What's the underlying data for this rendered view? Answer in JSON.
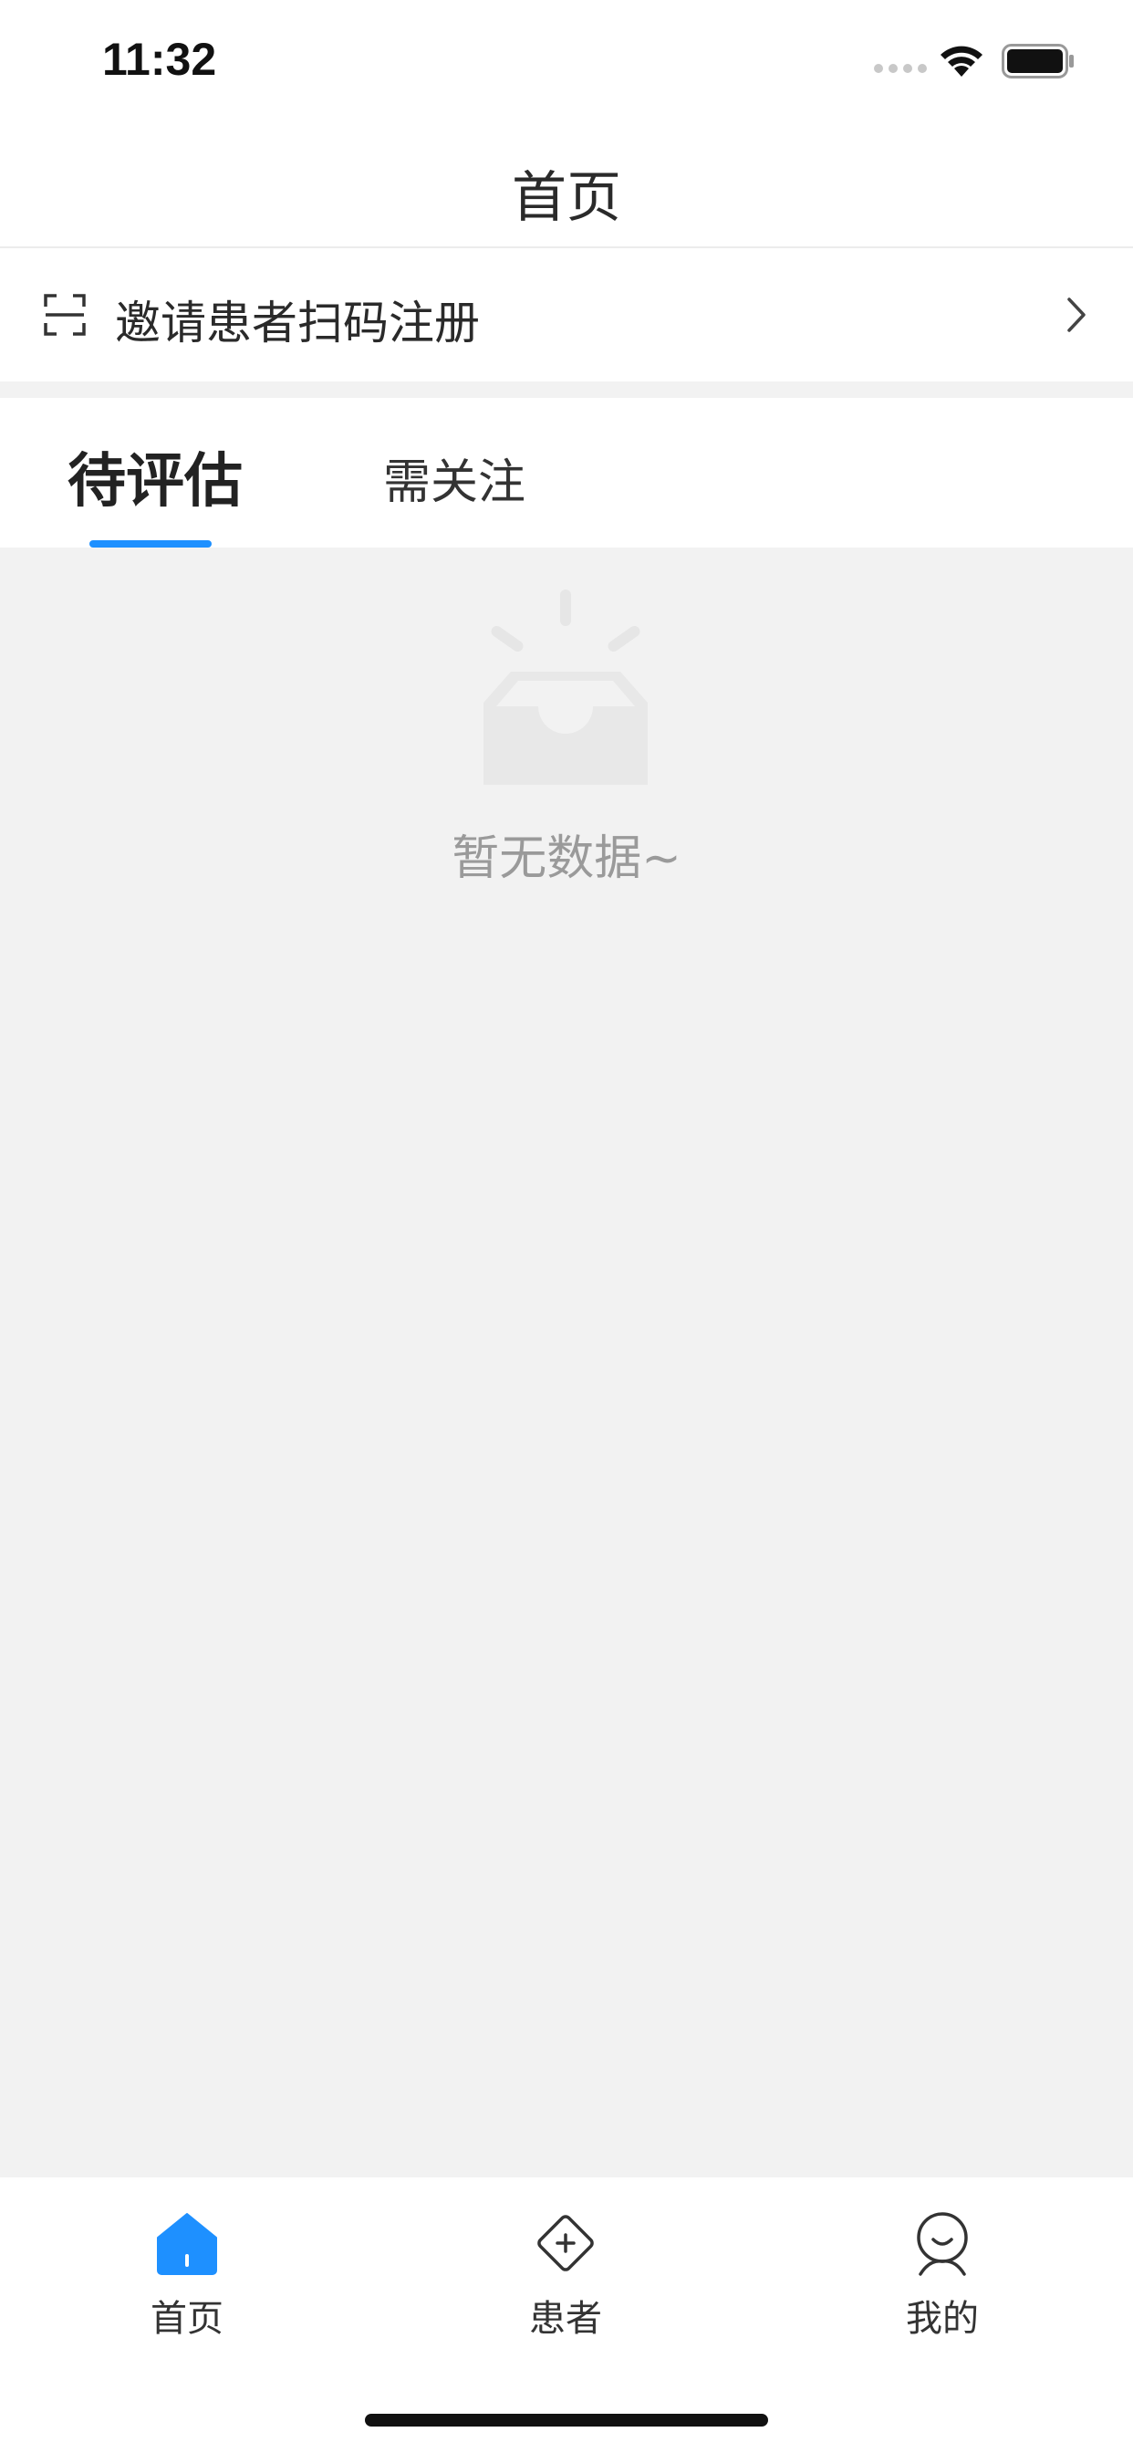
{
  "status_bar": {
    "time": "11:32"
  },
  "nav": {
    "title": "首页"
  },
  "invite": {
    "label": "邀请患者扫码注册"
  },
  "tabs": [
    {
      "label": "待评估",
      "active": true
    },
    {
      "label": "需关注",
      "active": false
    }
  ],
  "empty_state": {
    "text": "暂无数据~"
  },
  "tab_bar": {
    "items": [
      {
        "label": "首页",
        "icon": "home-icon",
        "active": true
      },
      {
        "label": "患者",
        "icon": "patient-plus-icon",
        "active": false
      },
      {
        "label": "我的",
        "icon": "profile-icon",
        "active": false
      }
    ]
  },
  "colors": {
    "accent": "#1e90ff",
    "background": "#f2f2f2",
    "text_primary": "#333333",
    "text_muted": "#9a9a9a"
  }
}
